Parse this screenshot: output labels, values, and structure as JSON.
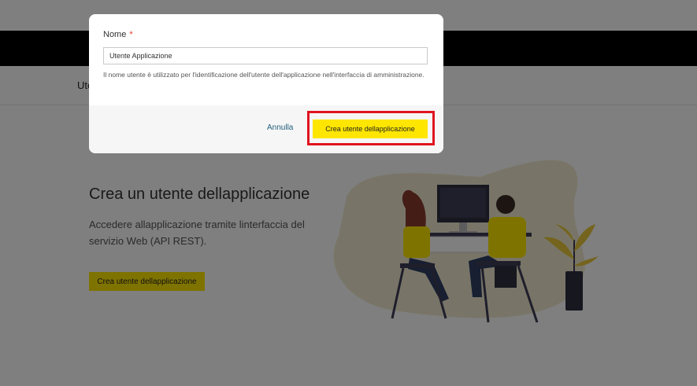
{
  "subnav": {
    "tab_label": "Ute"
  },
  "empty_state": {
    "title": "Crea un utente dellapplicazione",
    "description": "Accedere allapplicazione tramite linterfaccia del servizio Web (API REST).",
    "button_label": "Crea utente dellapplicazione"
  },
  "modal": {
    "name_label": "Nome",
    "required_marker": "*",
    "name_value": "Utente Applicazione",
    "name_help": "Il nome utente è utilizzato per l'identificazione dell'utente dell'applicazione nell'interfaccia di amministrazione.",
    "cancel_label": "Annulla",
    "confirm_label": "Crea utente dellapplicazione"
  },
  "colors": {
    "accent_yellow": "#ffe600",
    "highlight_red": "#e0141f",
    "link_teal": "#1f5f7a",
    "header_black": "#000000"
  }
}
